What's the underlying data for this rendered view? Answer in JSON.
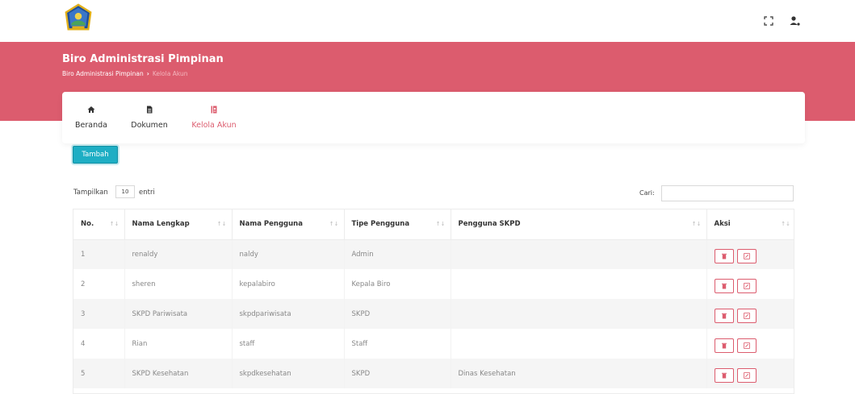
{
  "header": {
    "logo_alt": "logo",
    "icons": [
      "fullscreen-icon",
      "user-icon"
    ]
  },
  "page": {
    "title": "Biro Administrasi Pimpinan",
    "breadcrumb_root": "Biro Administrasi Pimpinan",
    "breadcrumb_separator": "›",
    "breadcrumb_current": "Kelola Akun"
  },
  "tabs": [
    {
      "label": "Beranda",
      "icon": "home-icon",
      "active": false
    },
    {
      "label": "Dokumen",
      "icon": "document-icon",
      "active": false
    },
    {
      "label": "Kelola Akun",
      "icon": "account-book-icon",
      "active": true
    }
  ],
  "toolbar": {
    "add_label": "Tambah"
  },
  "table_controls": {
    "length_prefix": "Tampilkan",
    "length_value": "10",
    "length_suffix": "entri",
    "search_label": "Cari:",
    "search_value": ""
  },
  "table": {
    "columns": [
      "No.",
      "Nama Lengkap",
      "Nama Pengguna",
      "Tipe Pengguna",
      "Pengguna SKPD",
      "Aksi"
    ],
    "rows": [
      [
        "1",
        "renaldy",
        "naldy",
        "Admin",
        ""
      ],
      [
        "2",
        "sheren",
        "kepalabiro",
        "Kepala Biro",
        ""
      ],
      [
        "3",
        "SKPD Pariwisata",
        "skpdpariwisata",
        "SKPD",
        ""
      ],
      [
        "4",
        "Rian",
        "staff",
        "Staff",
        ""
      ],
      [
        "5",
        "SKPD Kesehatan",
        "skpdkesehatan",
        "SKPD",
        "Dinas Kesehatan"
      ]
    ],
    "row_actions": [
      "delete-icon",
      "edit-icon"
    ]
  },
  "colors": {
    "accent": "#dc5c6e",
    "button": "#1eaec4"
  }
}
